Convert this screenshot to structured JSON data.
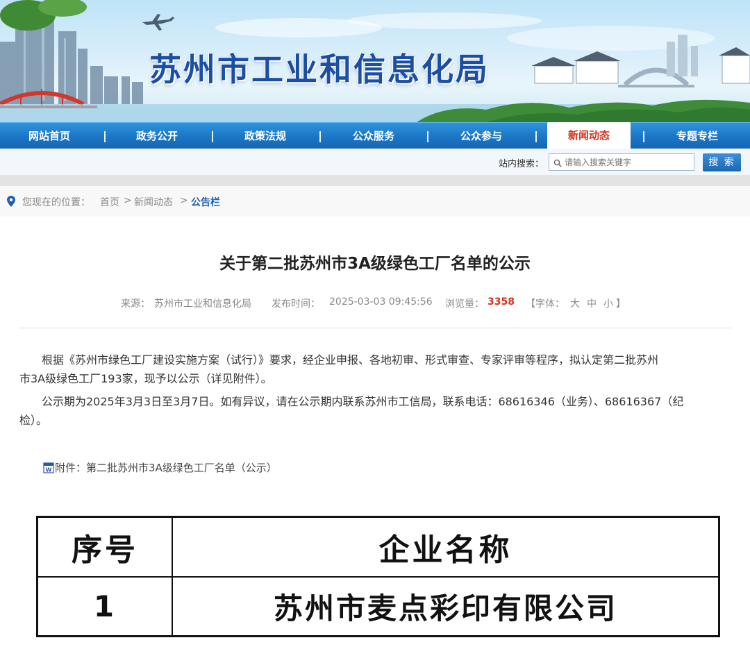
{
  "header": {
    "site_title": "苏州市工业和信息化局"
  },
  "nav": {
    "items": [
      {
        "label": "网站首页"
      },
      {
        "label": "政务公开"
      },
      {
        "label": "政策法规"
      },
      {
        "label": "公众服务"
      },
      {
        "label": "公众参与"
      },
      {
        "label": "新闻动态",
        "active": true
      },
      {
        "label": "专题专栏"
      }
    ]
  },
  "search": {
    "label": "站内搜索：",
    "placeholder": "请输入搜索关键字",
    "button": "搜 索"
  },
  "breadcrumb": {
    "prefix": "您现在的位置：",
    "home": "首页",
    "section": "新闻动态",
    "current": "公告栏",
    "separator": ">"
  },
  "article": {
    "title": "关于第二批苏州市3A级绿色工厂名单的公示",
    "source_label": "来源：",
    "source": "苏州市工业和信息化局",
    "time_label": "发布时间：",
    "time": "2025-03-03 09:45:56",
    "views_label": "浏览量：",
    "views": "3358",
    "font_label": "【字体：",
    "font_large": "大",
    "font_medium": "中",
    "font_small": "小",
    "font_close": "】",
    "paragraph_1_line_1": "根据《苏州市绿色工厂建设实施方案（试行）》要求，经企业申报、各地初审、形式审查、专家评审等程序，拟认定第二批苏州",
    "paragraph_1_line_2": "市3A级绿色工厂193家，现予以公示（详见附件）。",
    "paragraph_2_line_1": "公示期为2025年3月3日至3月7日。如有异议，请在公示期内联系苏州市工信局，联系电话：68616346（业务）、68616367（纪",
    "paragraph_2_line_2": "检）。",
    "attachment": "附件：第二批苏州市3A级绿色工厂名单（公示）"
  },
  "table": {
    "headers": [
      "序号",
      "企业名称"
    ],
    "rows": [
      [
        "1",
        "苏州市麦点彩印有限公司"
      ]
    ]
  },
  "colors": {
    "title_blue": "#1a4fa3",
    "nav_blue": "#1a74c4",
    "active_red": "#d2331f",
    "link_blue": "#1f5fb3"
  }
}
